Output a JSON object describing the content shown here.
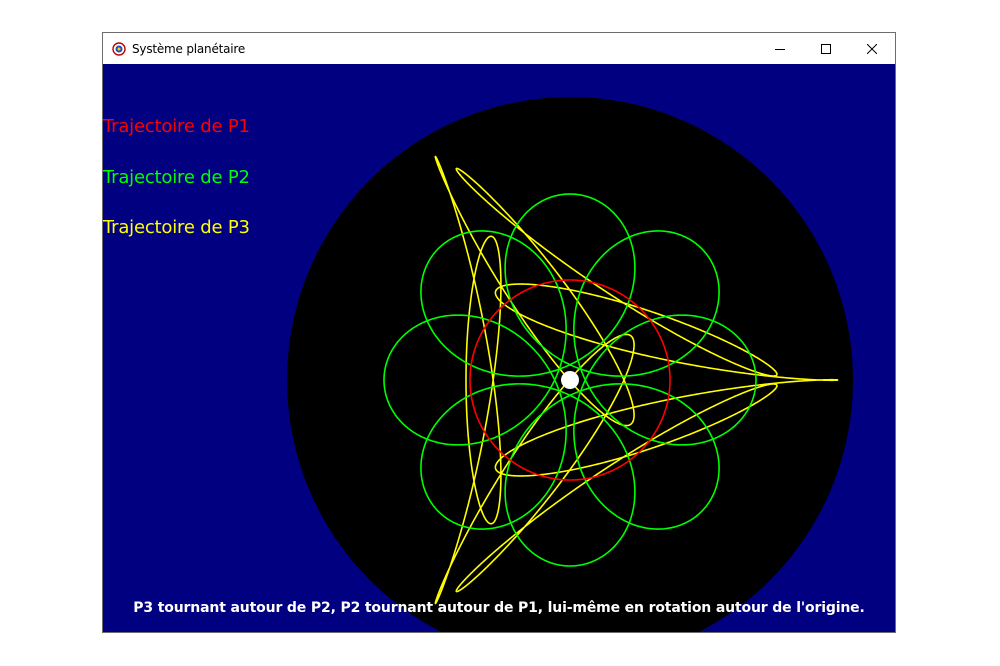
{
  "window": {
    "title": "Système planétaire",
    "controls": [
      "minimize-icon",
      "maximize-icon",
      "close-icon"
    ]
  },
  "legend": [
    {
      "label": "Trajectoire de P1",
      "color": "#ff0000"
    },
    {
      "label": "Trajectoire de P2",
      "color": "#00ff00"
    },
    {
      "label": "Trajectoire de P3",
      "color": "#ffff00"
    }
  ],
  "caption": "P3 tournant autour de P2, P2 tournant autour de P1, lui-même en rotation autour de l'origine.",
  "colors": {
    "background": "#000080",
    "disk": "#000000",
    "origin": "#ffffff"
  }
}
